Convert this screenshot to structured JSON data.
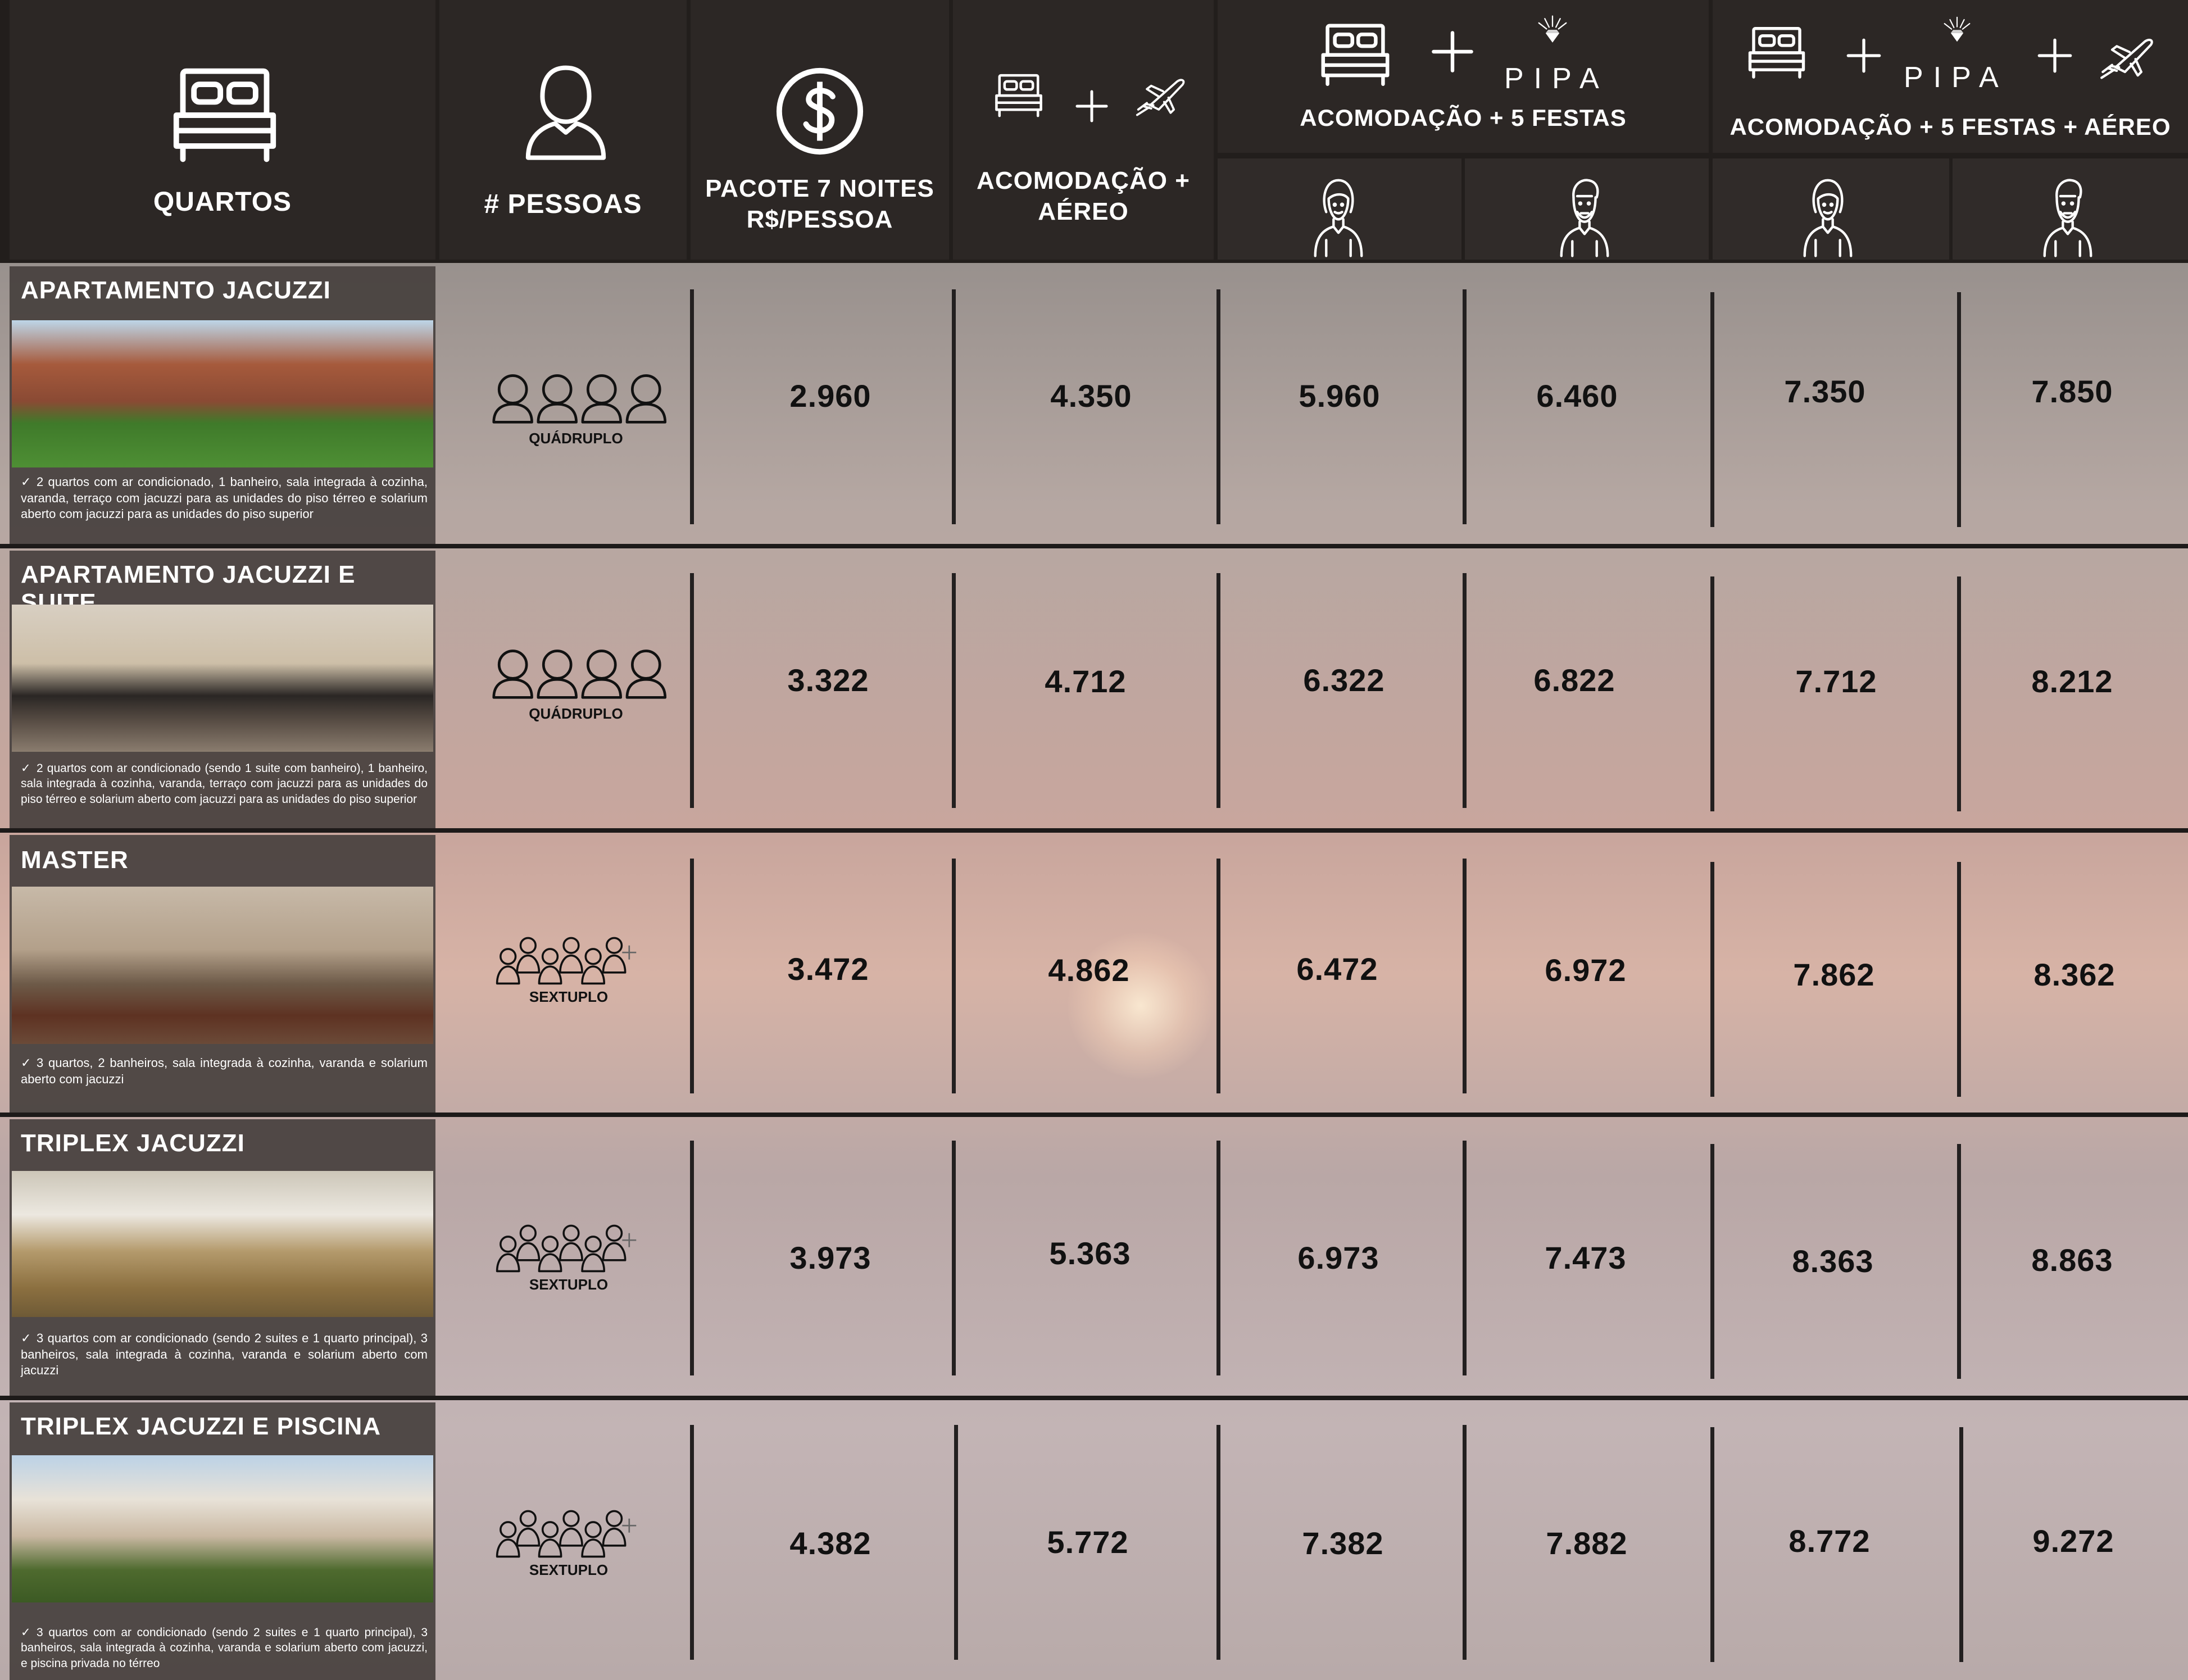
{
  "headers": {
    "quartos": "QUARTOS",
    "pessoas": "# PESSOAS",
    "pacote_line1": "PACOTE 7 NOITES",
    "pacote_line2": "R$/PESSOA",
    "acom_aereo_line1": "ACOMODAÇÃO +",
    "acom_aereo_line2": "AÉREO",
    "acom_festas": "ACOMODAÇÃO + 5 FESTAS",
    "acom_festas_aereo": "ACOMODAÇÃO + 5 FESTAS + AÉREO",
    "pipa_logo": "PIPA"
  },
  "icons": {
    "bed": "bed-icon",
    "person": "person-icon",
    "dollar": "dollar-icon",
    "plane": "airplane-icon",
    "plus": "plus-icon",
    "woman": "woman-icon",
    "man": "man-icon",
    "group": "group-icon"
  },
  "rooms": [
    {
      "name": "APARTAMENTO JACUZZI",
      "occupancy": "QUÁDRUPLO",
      "description": "2 quartos com ar condicionado, 1 banheiro, sala integrada à cozinha, varanda, terraço com jacuzzi para as unidades do piso térreo e solarium aberto com jacuzzi para as unidades do piso superior",
      "prices": [
        "2.960",
        "4.350",
        "5.960",
        "6.460",
        "7.350",
        "7.850"
      ]
    },
    {
      "name": "APARTAMENTO JACUZZI E SUITE",
      "occupancy": "QUÁDRUPLO",
      "description": "2 quartos com ar condicionado (sendo 1 suite com banheiro), 1 banheiro, sala integrada à cozinha, varanda, terraço com jacuzzi para as unidades do piso térreo e solarium aberto com jacuzzi para as unidades do piso superior",
      "prices": [
        "3.322",
        "4.712",
        "6.322",
        "6.822",
        "7.712",
        "8.212"
      ]
    },
    {
      "name": "MASTER",
      "occupancy": "SEXTUPLO",
      "description": "3 quartos, 2 banheiros, sala integrada à cozinha, varanda e solarium aberto com jacuzzi",
      "prices": [
        "3.472",
        "4.862",
        "6.472",
        "6.972",
        "7.862",
        "8.362"
      ]
    },
    {
      "name": "TRIPLEX JACUZZI",
      "occupancy": "SEXTUPLO",
      "description": "3 quartos com ar condicionado (sendo 2 suites e 1 quarto principal), 3 banheiros, sala integrada à cozinha, varanda e solarium aberto com jacuzzi",
      "prices": [
        "3.973",
        "5.363",
        "6.973",
        "7.473",
        "8.363",
        "8.863"
      ]
    },
    {
      "name": "TRIPLEX JACUZZI E PISCINA",
      "occupancy": "SEXTUPLO",
      "description": "3 quartos com ar condicionado (sendo 2 suites e 1 quarto principal), 3 banheiros, sala integrada à cozinha, varanda e solarium aberto com jacuzzi, e piscina privada no térreo",
      "prices": [
        "4.382",
        "5.772",
        "7.382",
        "7.882",
        "8.772",
        "9.272"
      ]
    }
  ],
  "colors": {
    "header_bg": "#2c2725",
    "text_dark": "#111111",
    "text_light": "#ffffff"
  }
}
